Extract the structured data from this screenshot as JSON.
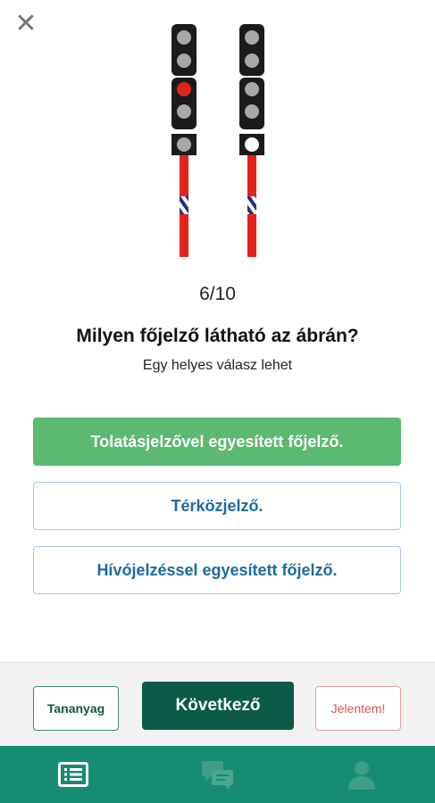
{
  "header": {
    "close_icon": "close-icon",
    "close_glyph": "✕"
  },
  "quiz": {
    "progress": "6/10",
    "question": "Milyen főjelző látható az ábrán?",
    "hint": "Egy helyes válasz lehet",
    "answers": [
      {
        "label": "Tolatásjelzővel egyesített főjelző.",
        "state": "correct"
      },
      {
        "label": "Térközjelző.",
        "state": "default"
      },
      {
        "label": "Hívójelzéssel egyesített főjelző.",
        "state": "default"
      }
    ]
  },
  "actions": {
    "learn_label": "Tananyag",
    "next_label": "Következő",
    "report_label": "Jelentem!"
  },
  "nav": {
    "items": [
      {
        "icon": "list-icon",
        "active": true
      },
      {
        "icon": "chat-icon",
        "active": false
      },
      {
        "icon": "person-icon",
        "active": false
      }
    ]
  },
  "colors": {
    "correct_answer_bg": "#5cb971",
    "primary": "#0b5a48",
    "nav_bg": "#168c74",
    "report": "#e25050",
    "answer_text": "#1d6a9e",
    "signal_red": "#e2231a"
  }
}
